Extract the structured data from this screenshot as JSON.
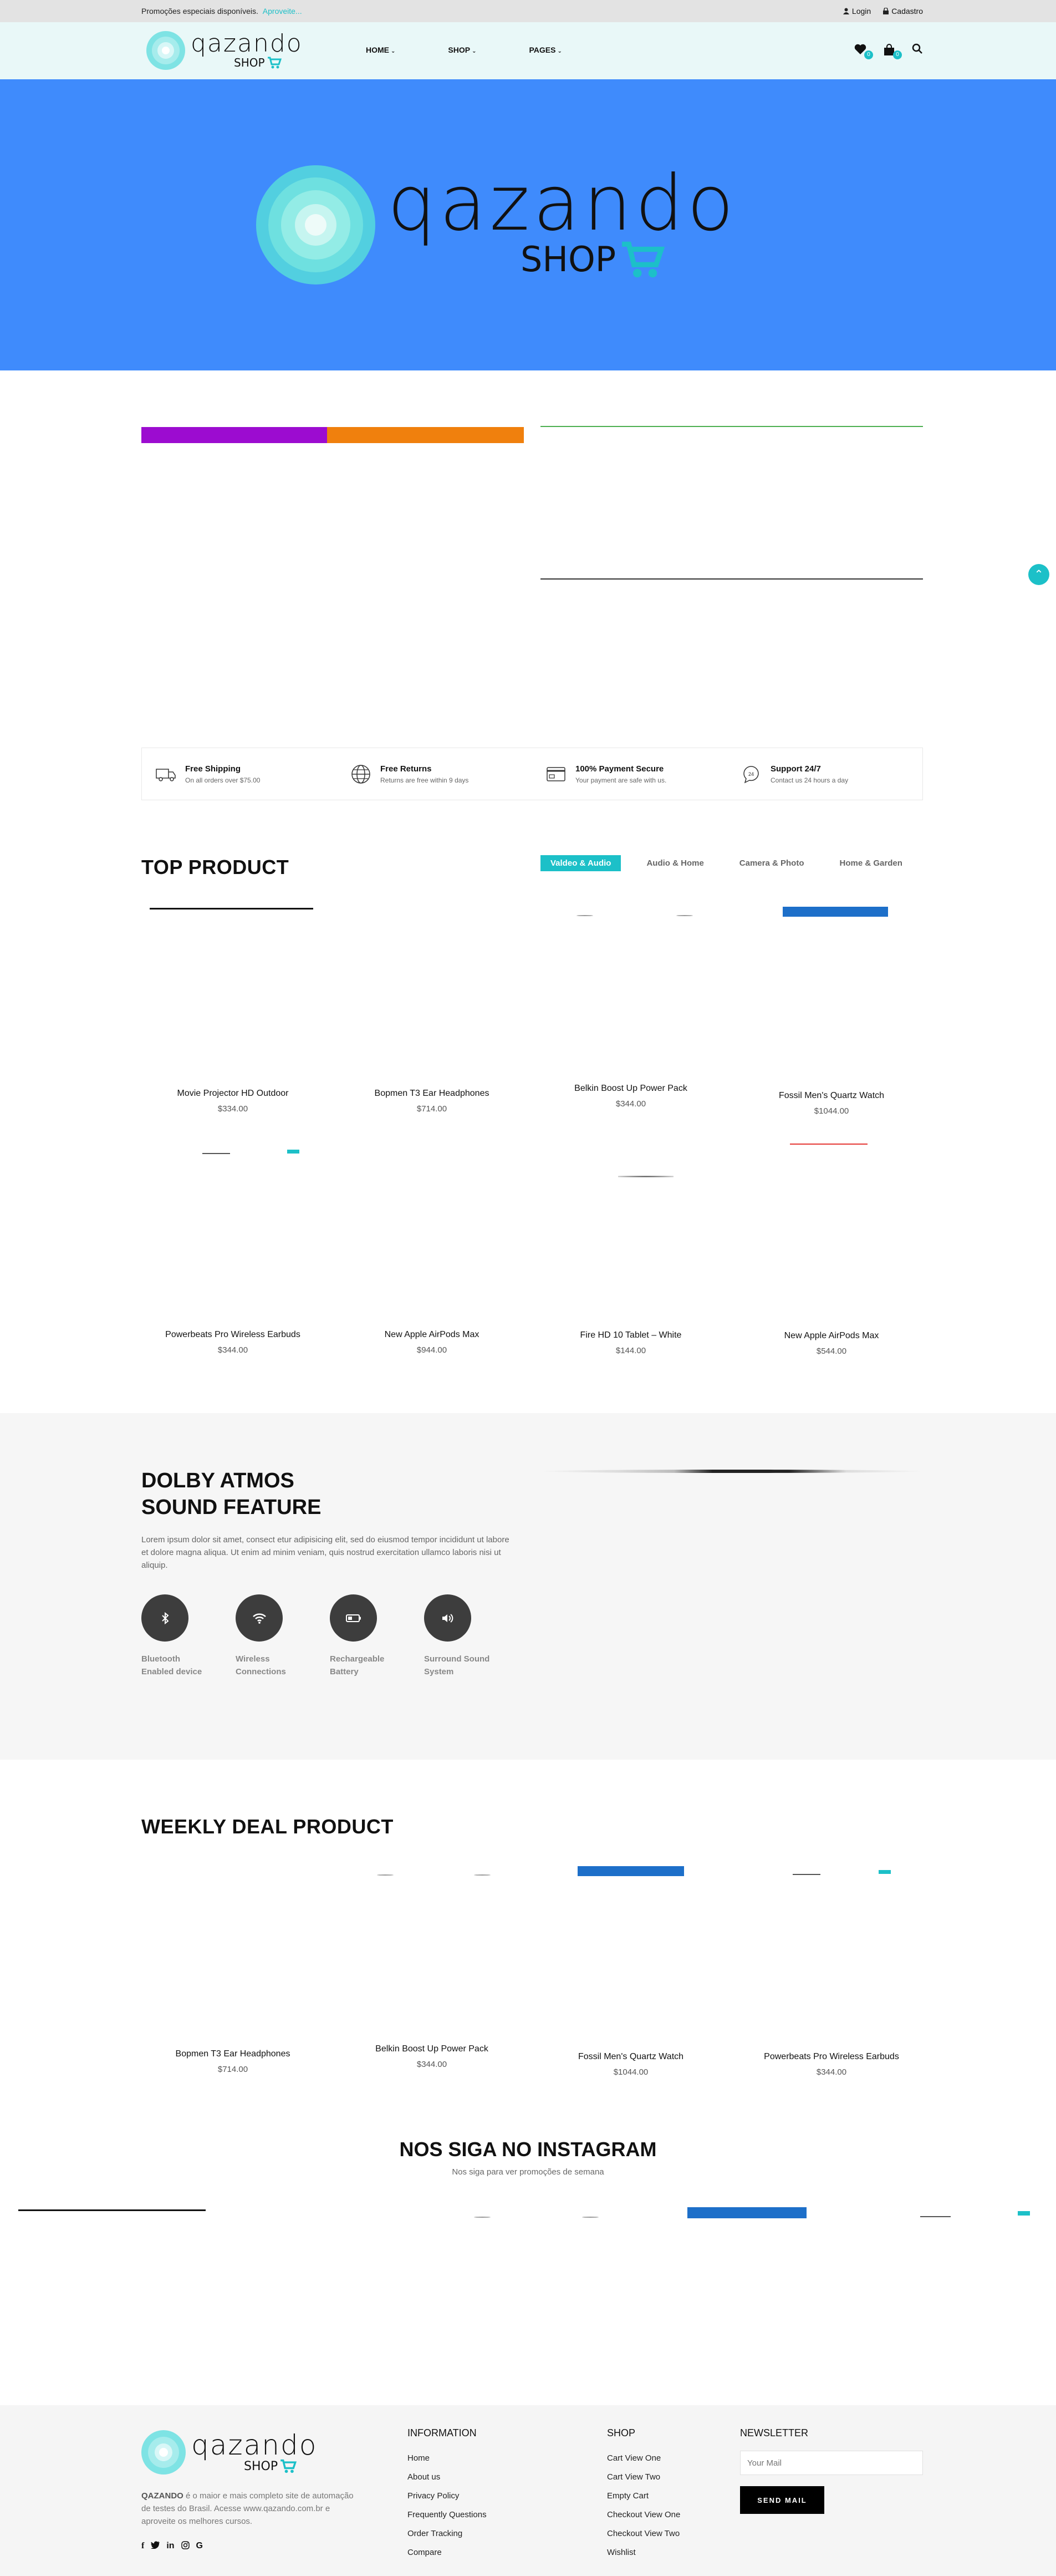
{
  "topbar": {
    "promo_text": "Promoções especiais disponíveis.",
    "promo_link": "Aproveite...",
    "login": "Login",
    "register": "Cadastro"
  },
  "header": {
    "logo_text": "qazando",
    "logo_sub": "SHOP",
    "nav": [
      "HOME",
      "SHOP",
      "PAGES"
    ],
    "wishlist_count": "0",
    "cart_count": "0"
  },
  "hero": {
    "logo_text": "qazando",
    "logo_sub": "SHOP",
    "background": "#3f8bfc"
  },
  "colors": {
    "accent": "#1cc0c8",
    "banner_purple": "#9c0cd0",
    "banner_orange": "#f0800d"
  },
  "features": [
    {
      "icon": "truck-icon",
      "title": "Free Shipping",
      "desc": "On all orders over $75.00"
    },
    {
      "icon": "globe-icon",
      "title": "Free Returns",
      "desc": "Returns are free within 9 days"
    },
    {
      "icon": "card-icon",
      "title": "100% Payment Secure",
      "desc": "Your payment are safe with us."
    },
    {
      "icon": "support-icon",
      "title": "Support 24/7",
      "desc": "Contact us 24 hours a day"
    }
  ],
  "top_product": {
    "title": "TOP PRODUCT",
    "tabs": [
      "Valdeo & Audio",
      "Audio & Home",
      "Camera & Photo",
      "Home & Garden"
    ],
    "active_tab": "Valdeo & Audio",
    "products": [
      {
        "name": "Movie Projector HD Outdoor",
        "price": "$334.00"
      },
      {
        "name": "Bopmen T3 Ear Headphones",
        "price": "$714.00"
      },
      {
        "name": "Belkin Boost Up Power Pack",
        "price": "$344.00"
      },
      {
        "name": "Fossil Men's Quartz Watch",
        "price": "$1044.00"
      },
      {
        "name": "Powerbeats Pro Wireless Earbuds",
        "price": "$344.00"
      },
      {
        "name": "New Apple AirPods Max",
        "price": "$944.00"
      },
      {
        "name": "Fire HD 10 Tablet – White",
        "price": "$144.00"
      },
      {
        "name": "New Apple AirPods Max",
        "price": "$544.00"
      }
    ]
  },
  "dolby": {
    "title_line1": "DOLBY ATMOS",
    "title_line2": "SOUND FEATURE",
    "text": "Lorem ipsum dolor sit amet, consect etur adipisicing elit, sed do eiusmod tempor incididunt ut labore et dolore magna aliqua. Ut enim ad minim veniam, quis nostrud exercitation ullamco laboris nisi ut aliquip.",
    "features": [
      {
        "icon": "bluetooth-icon",
        "line1": "Bluetooth",
        "line2": "Enabled device"
      },
      {
        "icon": "wifi-icon",
        "line1": "Wireless",
        "line2": "Connections"
      },
      {
        "icon": "battery-icon",
        "line1": "Rechargeable",
        "line2": "Battery"
      },
      {
        "icon": "speaker-icon",
        "line1": "Surround Sound",
        "line2": "System"
      }
    ]
  },
  "weekly": {
    "title": "WEEKLY DEAL PRODUCT",
    "products": [
      {
        "name": "Bopmen T3 Ear Headphones",
        "price": "$714.00"
      },
      {
        "name": "Belkin Boost Up Power Pack",
        "price": "$344.00"
      },
      {
        "name": "Fossil Men's Quartz Watch",
        "price": "$1044.00"
      },
      {
        "name": "Powerbeats Pro Wireless Earbuds",
        "price": "$344.00"
      }
    ]
  },
  "instagram": {
    "title": "NOS SIGA NO INSTAGRAM",
    "subtitle": "Nos siga para ver promoções de semana"
  },
  "footer": {
    "logo_text": "qazando",
    "logo_sub": "SHOP",
    "about_brand": "QAZANDO",
    "about_text": " é o maior e mais completo site de automação de testes do Brasil. Acesse www.qazando.com.br e aproveite os melhores cursos.",
    "information": {
      "title": "INFORMATION",
      "links": [
        "Home",
        "About us",
        "Privacy Policy",
        "Frequently Questions",
        "Order Tracking",
        "Compare"
      ]
    },
    "shop": {
      "title": "SHOP",
      "links": [
        "Cart View One",
        "Cart View Two",
        "Empty Cart",
        "Checkout View One",
        "Checkout View Two",
        "Wishlist"
      ]
    },
    "newsletter": {
      "title": "NEWSLETTER",
      "placeholder": "Your Mail",
      "button": "SEND MAIL"
    }
  }
}
